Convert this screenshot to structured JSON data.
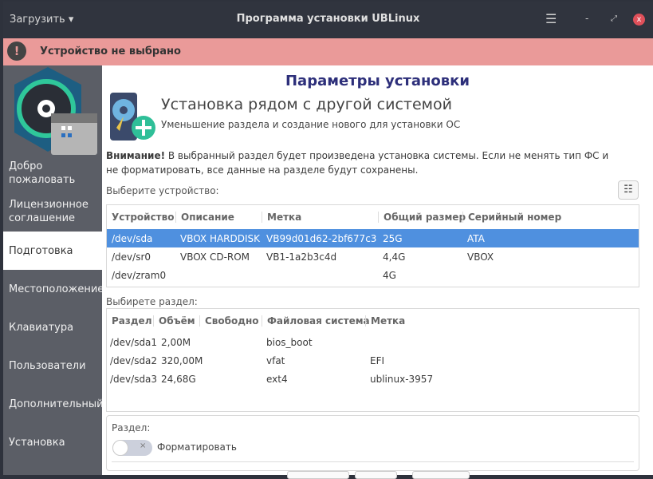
{
  "titlebar": {
    "load_menu": "Загрузить",
    "title": "Программа установки UBLinux"
  },
  "alert": {
    "text": "Устройство не выбрано"
  },
  "sidebar": {
    "items": [
      {
        "label": "Добро пожаловать"
      },
      {
        "label": "Лицензионное соглашение"
      },
      {
        "label": "Подготовка"
      },
      {
        "label": "Местоположение"
      },
      {
        "label": "Клавиатура"
      },
      {
        "label": "Пользователи"
      },
      {
        "label": "Дополнительный"
      },
      {
        "label": "Установка"
      }
    ]
  },
  "main": {
    "heading": "Параметры установки",
    "mode_title": "Установка рядом с другой системой",
    "mode_subtitle": "Уменьшение раздела и создание нового для установки ОС",
    "warning_bold": "Внимание!",
    "warning_text": " В выбранный раздел будет произведена установка системы. Если не менять тип ФС и не форматировать, все данные на разделе будут сохранены.",
    "device_label": "Выберите устройство:",
    "device_headers": [
      "Устройство",
      "Описание",
      "Метка",
      "Общий размер",
      "Серийный номер"
    ],
    "devices": [
      [
        "/dev/sda",
        "VBOX HARDDISK",
        "VB99d01d62-2bf677c3",
        "25G",
        "ATA"
      ],
      [
        "/dev/sr0",
        "VBOX CD-ROM",
        "VB1-1a2b3c4d",
        "4,4G",
        "VBOX"
      ],
      [
        "/dev/zram0",
        "",
        "",
        "4G",
        ""
      ]
    ],
    "partition_label": "Выбирете раздел:",
    "partition_headers": [
      "Раздел",
      "Объём",
      "Свободно",
      "Файловая система",
      "Метка"
    ],
    "partitions": [
      [
        "/dev/sda1",
        "2,00M",
        "",
        "bios_boot",
        ""
      ],
      [
        "/dev/sda2",
        "320,00M",
        "",
        "vfat",
        "EFI"
      ],
      [
        "/dev/sda3",
        "24,68G",
        "",
        "ext4",
        "ublinux-3957"
      ]
    ],
    "section_label": "Раздел:",
    "format_label": "Форматировать",
    "format_on": false
  },
  "colors": {
    "selection": "#4f90df",
    "alert": "#ea9a99",
    "heading": "#2d2f7a"
  }
}
